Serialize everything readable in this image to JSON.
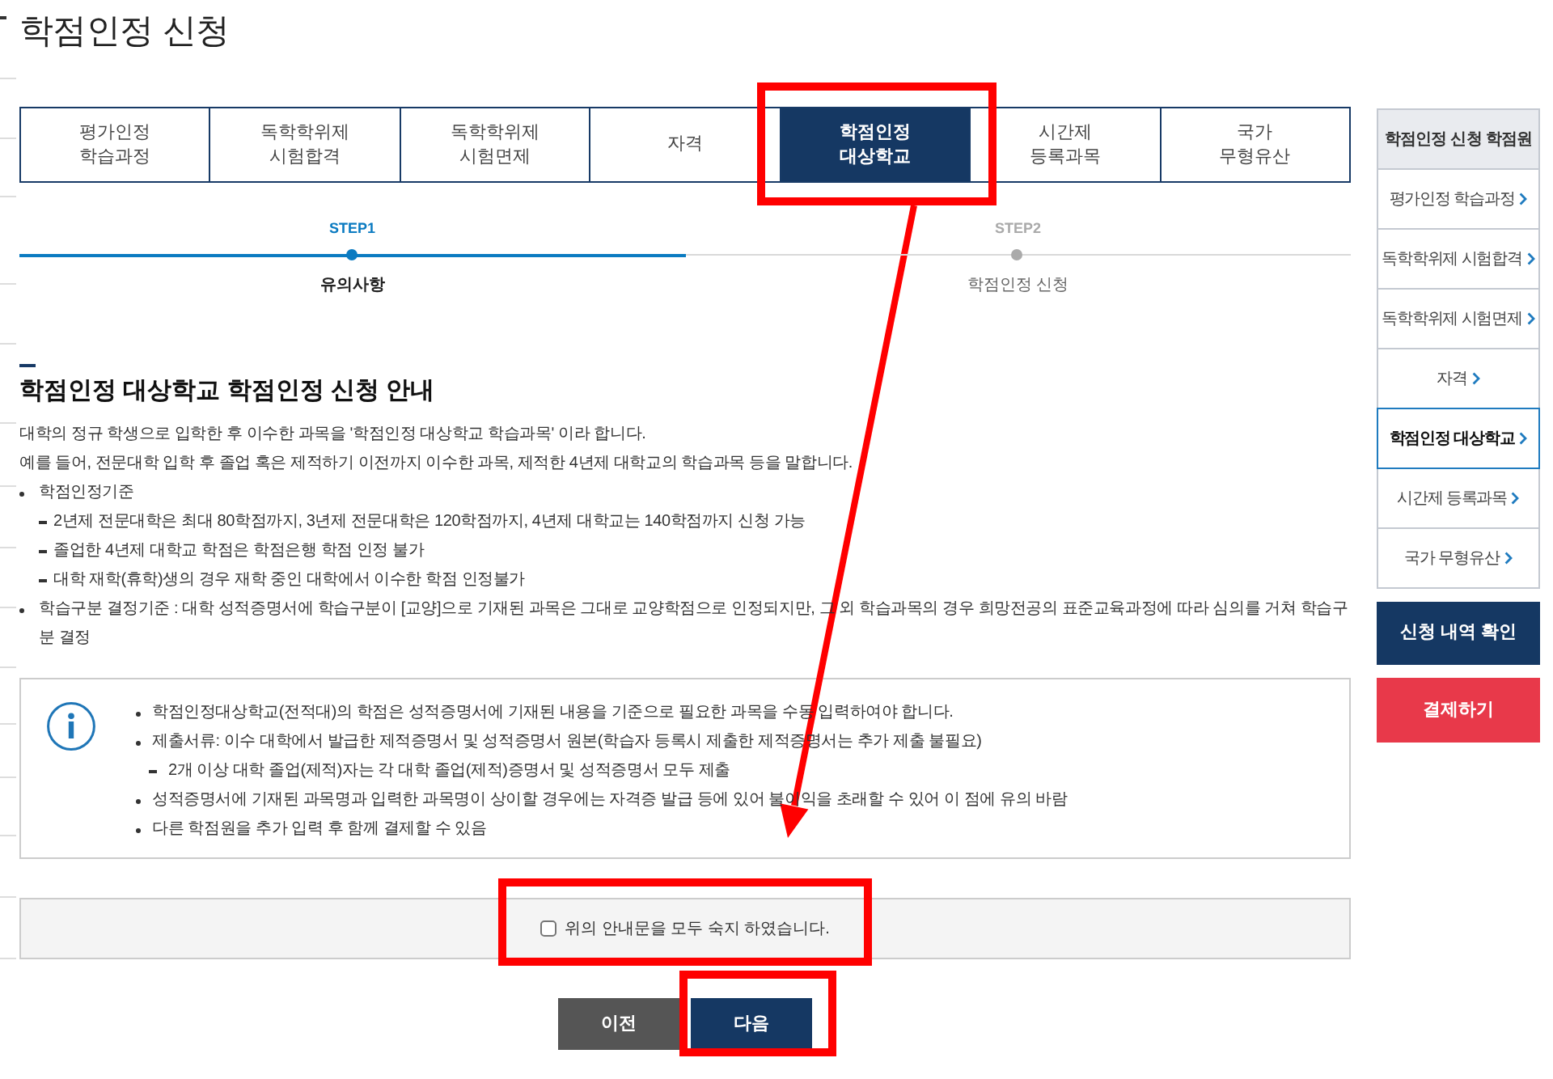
{
  "page_title": "학점인정 신청",
  "tabs": [
    {
      "lines": [
        "평가인정",
        "학습과정"
      ],
      "selected": false
    },
    {
      "lines": [
        "독학학위제",
        "시험합격"
      ],
      "selected": false
    },
    {
      "lines": [
        "독학학위제",
        "시험면제"
      ],
      "selected": false
    },
    {
      "lines": [
        "자격"
      ],
      "selected": false
    },
    {
      "lines": [
        "학점인정",
        "대상학교"
      ],
      "selected": true
    },
    {
      "lines": [
        "시간제",
        "등록과목"
      ],
      "selected": false
    },
    {
      "lines": [
        "국가",
        "무형유산"
      ],
      "selected": false
    }
  ],
  "steps": [
    {
      "number": "STEP1",
      "label": "유의사항",
      "selected": true
    },
    {
      "number": "STEP2",
      "label": "학점인정 신청",
      "selected": false
    }
  ],
  "notice": {
    "heading": "학점인정 대상학교 학점인정 신청 안내",
    "paragraphs": [
      "대학의 정규 학생으로 입학한 후 이수한 과목을 '학점인정 대상학교 학습과목' 이라 합니다.",
      "예를 들어, 전문대학 입학 후 졸업 혹은 제적하기 이전까지 이수한 과목, 제적한 4년제 대학교의 학습과목 등을 말합니다."
    ],
    "items": [
      {
        "text": "학점인정기준",
        "children": [
          {
            "text": "2년제 전문대학은 최대 80학점까지, 3년제 전문대학은 120학점까지, 4년제 대학교는 140학점까지 신청 가능"
          },
          {
            "text": "졸업한 4년제 대학교 학점은 학점은행 학점 인정 불가"
          },
          {
            "text": "대학 재학(휴학)생의 경우 재학 중인 대학에서 이수한 학점 인정불가"
          }
        ]
      },
      {
        "text": "학습구분 결정기준 : 대학 성적증명서에 학습구분이 [교양]으로 기재된 과목은 그대로 교양학점으로 인정되지만, 그 외 학습과목의 경우 희망전공의 표준교육과정에 따라 심의를 거쳐 학습구분 결정"
      }
    ]
  },
  "info_box": {
    "items": [
      {
        "text": "학점인정대상학교(전적대)의 학점은 성적증명서에 기재된 내용을 기준으로 필요한 과목을 수동 입력하여야 합니다."
      },
      {
        "text": "제출서류: 이수 대학에서 발급한 제적증명서 및 성적증명서 원본(학습자 등록시 제출한 제적증명서는 추가 제출 불필요)",
        "children": [
          {
            "text": "2개 이상 대학 졸업(제적)자는 각 대학 졸업(제적)증명서 및 성적증명서 모두 제출"
          }
        ]
      },
      {
        "text": "성적증명서에 기재된 과목명과 입력한 과목명이 상이할 경우에는 자격증 발급 등에 있어 불이익을 초래할 수 있어 이 점에 유의 바람"
      },
      {
        "text": "다른 학점원을 추가 입력 후 함께 결제할 수 있음"
      }
    ]
  },
  "agreement": {
    "label": "위의 안내문을 모두 숙지 하였습니다.",
    "checked": false
  },
  "buttons": [
    {
      "label": "이전",
      "kind": "secondary"
    },
    {
      "label": "다음",
      "kind": "primary"
    }
  ],
  "sidebar": {
    "title": "학점인정 신청 학점원",
    "items": [
      {
        "label": "평가인정 학습과정",
        "selected": false
      },
      {
        "label": "독학학위제 시험합격",
        "selected": false
      },
      {
        "label": "독학학위제 시험면제",
        "selected": false
      },
      {
        "label": "자격",
        "selected": false
      },
      {
        "label": "학점인정 대상학교",
        "selected": true
      },
      {
        "label": "시간제 등록과목",
        "selected": false
      },
      {
        "label": "국가 무형유산",
        "selected": false
      }
    ],
    "actions": [
      {
        "label": "신청 내역 확인",
        "kind": "primary"
      },
      {
        "label": "결제하기",
        "kind": "danger"
      }
    ]
  }
}
